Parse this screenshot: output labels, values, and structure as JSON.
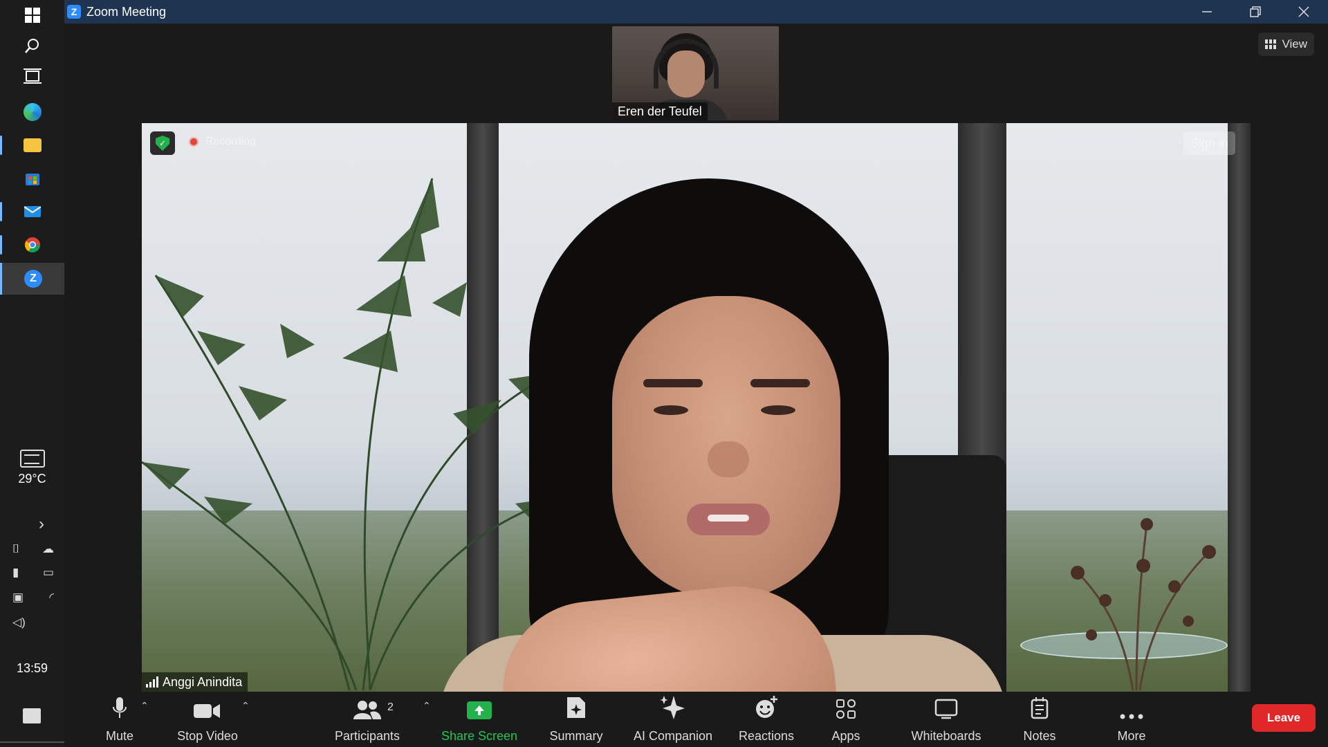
{
  "window": {
    "title": "Zoom Meeting",
    "logo_letter": "Z"
  },
  "taskbar": {
    "weather_temp": "29°C",
    "clock": "13:59",
    "icons": [
      "windows-start-icon",
      "search-icon",
      "task-view-icon",
      "edge-icon",
      "file-explorer-icon",
      "microsoft-store-icon",
      "mail-icon",
      "chrome-icon",
      "zoom-icon"
    ]
  },
  "meeting": {
    "view_label": "View",
    "thumbnail": {
      "name": "Eren der Teufel"
    },
    "speaker": {
      "name": "Anggi Anindita",
      "recording_label": "Recording",
      "signin_label": "Sign in"
    }
  },
  "toolbar": {
    "mute": "Mute",
    "stop_video": "Stop Video",
    "participants": "Participants",
    "participants_count": "2",
    "share_screen": "Share Screen",
    "summary": "Summary",
    "ai_companion": "AI Companion",
    "reactions": "Reactions",
    "apps": "Apps",
    "whiteboards": "Whiteboards",
    "notes": "Notes",
    "more": "More",
    "leave": "Leave"
  },
  "colors": {
    "titlebar": "#1f3450",
    "accent_blue": "#2d8cff",
    "share_green": "#23b14d",
    "leave_red": "#e02828"
  }
}
